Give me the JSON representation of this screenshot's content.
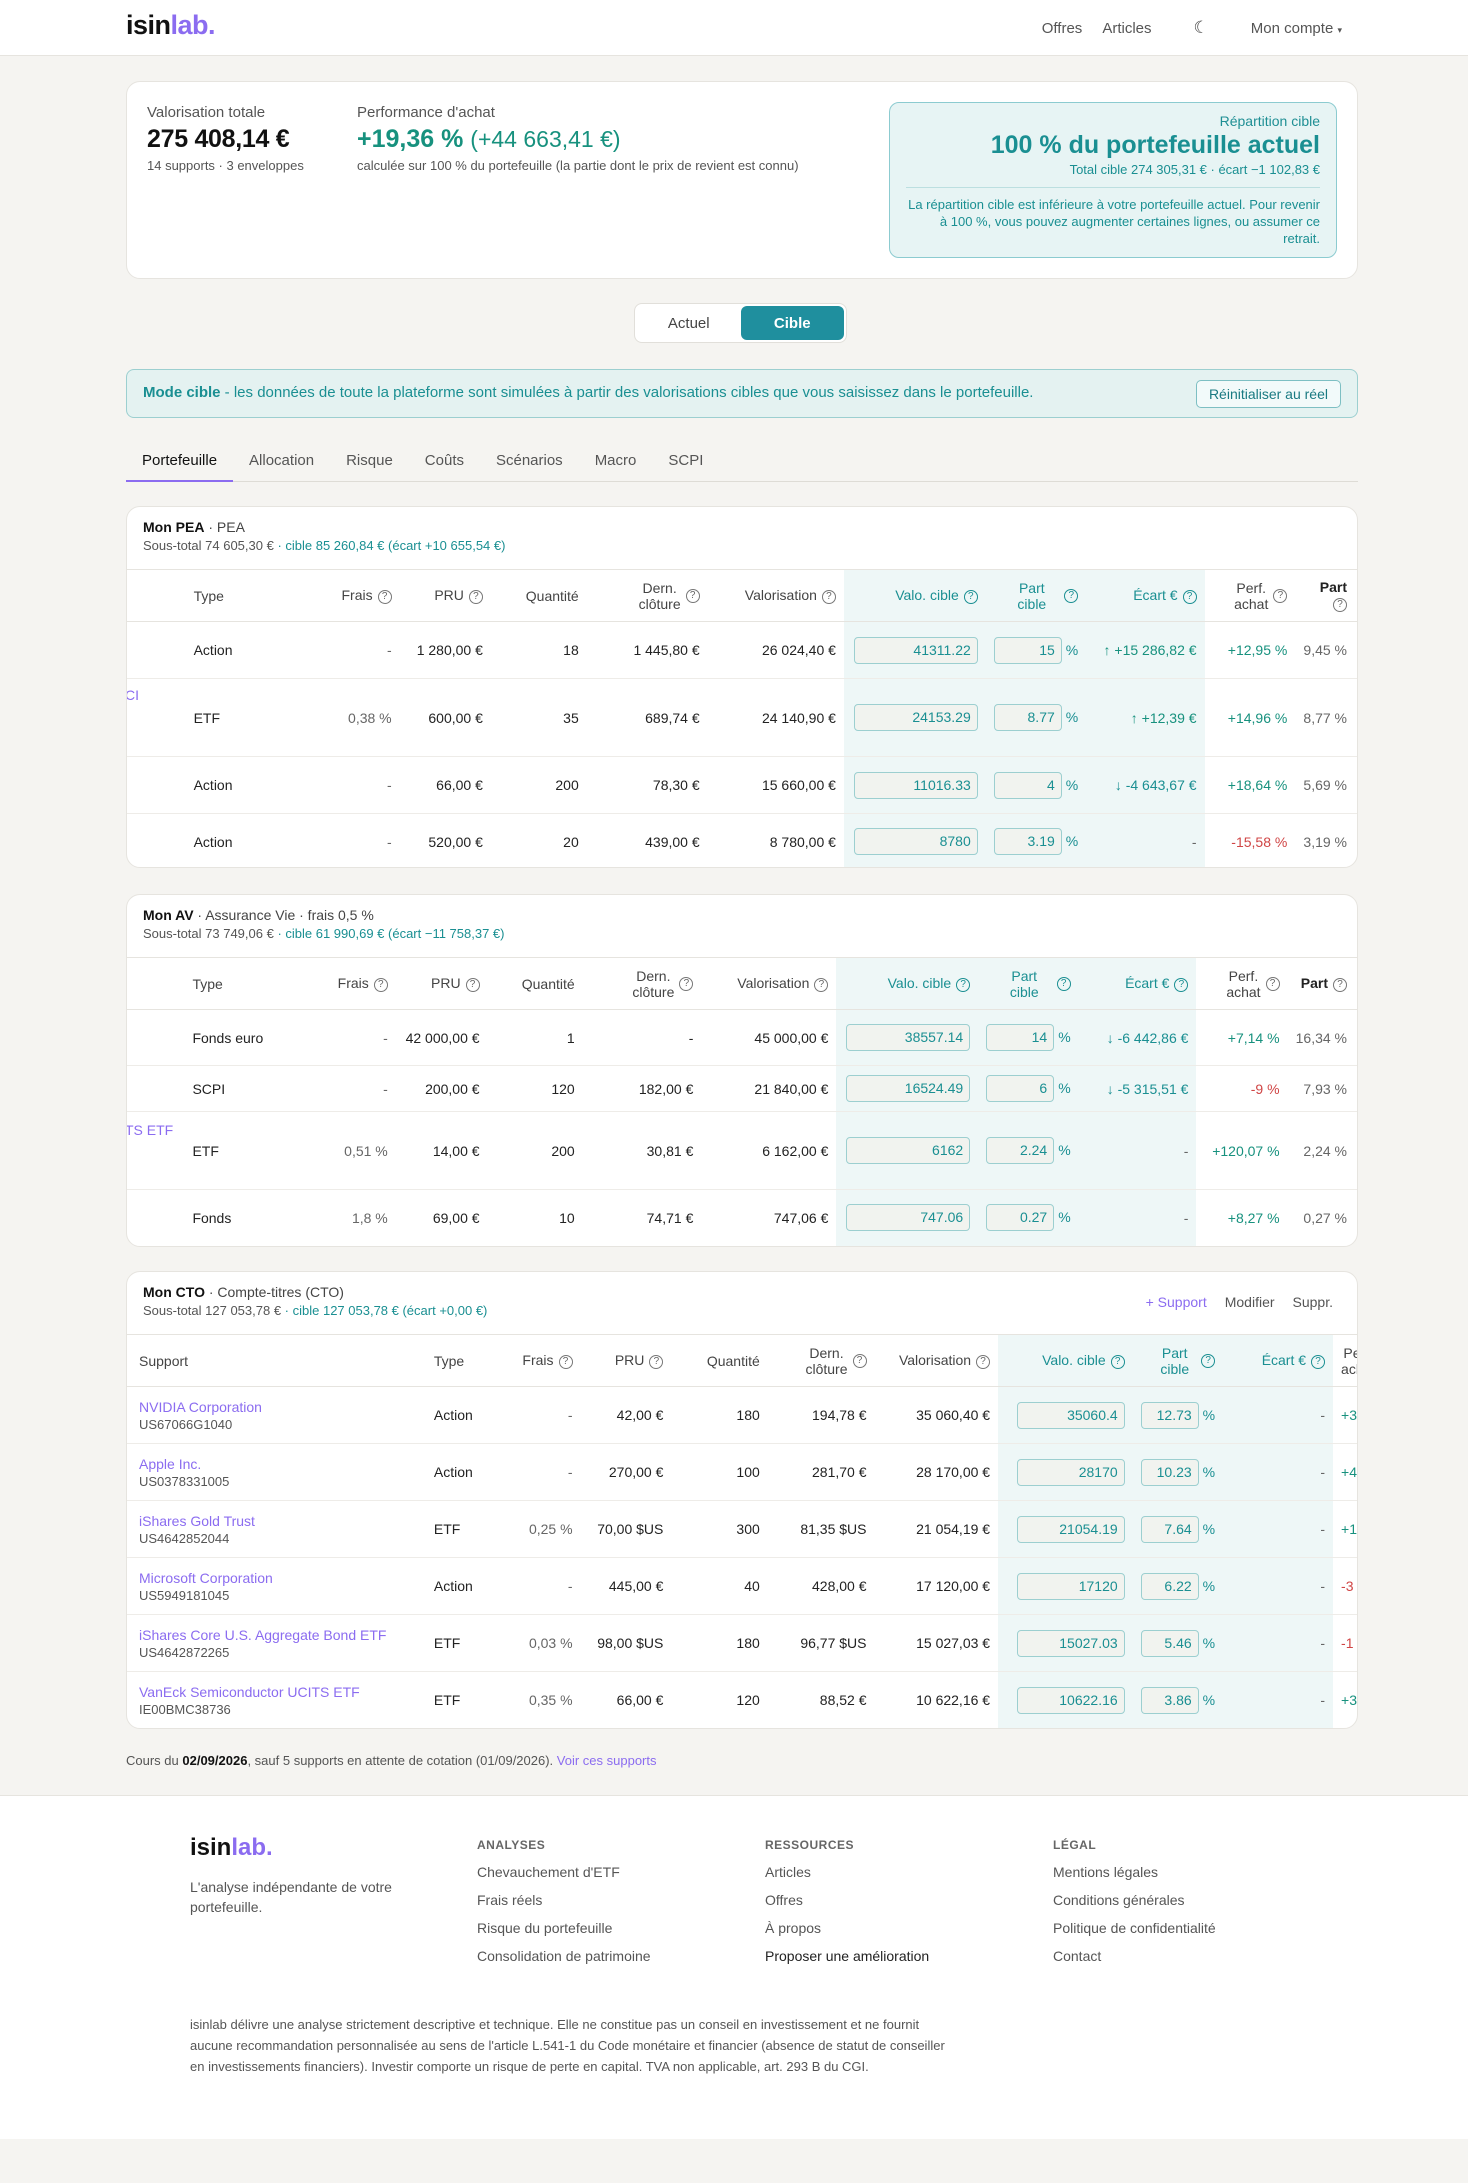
{
  "header": {
    "logo_a": "isin",
    "logo_b": "lab",
    "logo_dot": ".",
    "nav": [
      "Offres",
      "Articles"
    ],
    "theme_icon": "moon-icon",
    "account": "Mon compte"
  },
  "summary": {
    "total_label": "Valorisation totale",
    "total_value": "275 408,14 €",
    "total_sub": "14 supports · 3 enveloppes",
    "perf_label": "Performance d'achat",
    "perf_value": "+19,36 %",
    "perf_abs": "(+44 663,41 €)",
    "perf_sub": "calculée sur 100 % du portefeuille (la partie dont le prix de revient est connu)",
    "target_label": "Répartition cible",
    "target_big": "100 % du portefeuille actuel",
    "target_sub": "Total cible 274 305,31 € · écart −1 102,83 €",
    "target_note": "La répartition cible est inférieure à votre portefeuille actuel. Pour revenir à 100 %, vous pouvez augmenter certaines lignes, ou assumer ce retrait."
  },
  "toggle": {
    "actual": "Actuel",
    "target": "Cible"
  },
  "banner": {
    "title": "Mode cible",
    "text": " - les données de toute la plateforme sont simulées à partir des valorisations cibles que vous saisissez dans le portefeuille.",
    "reset": "Réinitialiser au réel"
  },
  "tabs": [
    "Portefeuille",
    "Allocation",
    "Risque",
    "Coûts",
    "Scénarios",
    "Macro",
    "SCPI"
  ],
  "cols": {
    "support": "Support",
    "type": "Type",
    "frais": "Frais",
    "pru": "PRU",
    "qty": "Quantité",
    "close1": "Dern.",
    "close2": "clôture",
    "valo": "Valorisation",
    "valo_t": "Valo. cible",
    "part_t1": "Part",
    "part_t2": "cible",
    "ecart": "Écart €",
    "perf1": "Perf.",
    "perf2": "achat",
    "part": "Part"
  },
  "pea": {
    "title": "Mon PEA",
    "kind": " · PEA",
    "sub": "Sous-total 74 605,30 € ",
    "sub_target": "· cible 85 260,84 € (écart +10 655,54 €)",
    "stub": "CI",
    "rows": [
      {
        "type": "Action",
        "frais": "-",
        "pru": "1 280,00 €",
        "qty": "18",
        "close": "1 445,80 €",
        "valo": "26 024,40 €",
        "valo_t": "41311.22",
        "part_t": "15",
        "ecart": "↑ +15 286,82 €",
        "perf": "+12,95 %",
        "part": "9,45 %"
      },
      {
        "type": "ETF",
        "frais": "0,38 %",
        "pru": "600,00 €",
        "qty": "35",
        "close": "689,74 €",
        "valo": "24 140,90 €",
        "valo_t": "24153.29",
        "part_t": "8.77",
        "ecart": "↑ +12,39 €",
        "perf": "+14,96 %",
        "part": "8,77 %"
      },
      {
        "type": "Action",
        "frais": "-",
        "pru": "66,00 €",
        "qty": "200",
        "close": "78,30 €",
        "valo": "15 660,00 €",
        "valo_t": "11016.33",
        "part_t": "4",
        "ecart": "↓ -4 643,67 €",
        "perf": "+18,64 %",
        "part": "5,69 %"
      },
      {
        "type": "Action",
        "frais": "-",
        "pru": "520,00 €",
        "qty": "20",
        "close": "439,00 €",
        "valo": "8 780,00 €",
        "valo_t": "8780",
        "part_t": "3.19",
        "ecart": "-",
        "perf": "-15,58 %",
        "part": "3,19 %"
      }
    ]
  },
  "av": {
    "title": "Mon AV",
    "kind": " · Assurance Vie · frais 0,5 %",
    "sub": "Sous-total 73 749,06 € ",
    "sub_target": "· cible 61 990,69 € (écart −11 758,37 €)",
    "stub": "TS ETF",
    "rows": [
      {
        "type": "Fonds euro",
        "frais": "-",
        "pru": "42 000,00 €",
        "qty": "1",
        "close": "-",
        "valo": "45 000,00 €",
        "valo_t": "38557.14",
        "part_t": "14",
        "ecart": "↓ -6 442,86 €",
        "perf": "+7,14 %",
        "part": "16,34 %"
      },
      {
        "type": "SCPI",
        "frais": "-",
        "pru": "200,00 €",
        "qty": "120",
        "close": "182,00 €",
        "valo": "21 840,00 €",
        "valo_t": "16524.49",
        "part_t": "6",
        "ecart": "↓ -5 315,51 €",
        "perf": "-9 %",
        "part": "7,93 %"
      },
      {
        "type": "ETF",
        "frais": "0,51 %",
        "pru": "14,00 €",
        "qty": "200",
        "close": "30,81 €",
        "valo": "6 162,00 €",
        "valo_t": "6162",
        "part_t": "2.24",
        "ecart": "-",
        "perf": "+120,07 %",
        "part": "2,24 %"
      },
      {
        "type": "Fonds",
        "frais": "1,8 %",
        "pru": "69,00 €",
        "qty": "10",
        "close": "74,71 €",
        "valo": "747,06 €",
        "valo_t": "747.06",
        "part_t": "0.27",
        "ecart": "-",
        "perf": "+8,27 %",
        "part": "0,27 %"
      }
    ]
  },
  "cto": {
    "title": "Mon CTO",
    "kind": " · Compte-titres (CTO)",
    "sub": "Sous-total 127 053,78 € ",
    "sub_target": "· cible 127 053,78 € (écart +0,00 €)",
    "actions": {
      "add": "+ Support",
      "edit": "Modifier",
      "del": "Suppr."
    },
    "rows": [
      {
        "name": "NVIDIA Corporation",
        "isin": "US67066G1040",
        "type": "Action",
        "frais": "-",
        "pru": "42,00 €",
        "qty": "180",
        "close": "194,78 €",
        "valo": "35 060,40 €",
        "valo_t": "35060.4",
        "part_t": "12.73",
        "ecart": "-",
        "perf": "+3"
      },
      {
        "name": "Apple Inc.",
        "isin": "US0378331005",
        "type": "Action",
        "frais": "-",
        "pru": "270,00 €",
        "qty": "100",
        "close": "281,70 €",
        "valo": "28 170,00 €",
        "valo_t": "28170",
        "part_t": "10.23",
        "ecart": "-",
        "perf": "+4"
      },
      {
        "name": "iShares Gold Trust",
        "isin": "US4642852044",
        "type": "ETF",
        "frais": "0,25 %",
        "pru": "70,00 $US",
        "qty": "300",
        "close": "81,35 $US",
        "valo": "21 054,19 €",
        "valo_t": "21054.19",
        "part_t": "7.64",
        "ecart": "-",
        "perf": "+1("
      },
      {
        "name": "Microsoft Corporation",
        "isin": "US5949181045",
        "type": "Action",
        "frais": "-",
        "pru": "445,00 €",
        "qty": "40",
        "close": "428,00 €",
        "valo": "17 120,00 €",
        "valo_t": "17120",
        "part_t": "6.22",
        "ecart": "-",
        "perf": "-3"
      },
      {
        "name": "iShares Core U.S. Aggregate Bond ETF",
        "isin": "US4642872265",
        "type": "ETF",
        "frais": "0,03 %",
        "pru": "98,00 $US",
        "qty": "180",
        "close": "96,77 $US",
        "valo": "15 027,03 €",
        "valo_t": "15027.03",
        "part_t": "5.46",
        "ecart": "-",
        "perf": "-1"
      },
      {
        "name": "VanEck Semiconductor UCITS ETF",
        "isin": "IE00BMC38736",
        "type": "ETF",
        "frais": "0,35 %",
        "pru": "66,00 €",
        "qty": "120",
        "close": "88,52 €",
        "valo": "10 622,16 €",
        "valo_t": "10622.16",
        "part_t": "3.86",
        "ecart": "-",
        "perf": "+3"
      }
    ]
  },
  "footnote": {
    "a": "Cours du ",
    "date": "02/09/2026",
    "b": ", sauf 5 supports en attente de cotation (01/09/2026). ",
    "link": "Voir ces supports"
  },
  "footer": {
    "tagline": "L'analyse indépendante de votre portefeuille.",
    "cols": [
      {
        "title": "ANALYSES",
        "items": [
          "Chevauchement d'ETF",
          "Frais réels",
          "Risque du portefeuille",
          "Consolidation de patrimoine"
        ]
      },
      {
        "title": "RESSOURCES",
        "items": [
          "Articles",
          "Offres",
          "À propos",
          "Proposer une amélioration"
        ]
      },
      {
        "title": "LÉGAL",
        "items": [
          "Mentions légales",
          "Conditions générales",
          "Politique de confidentialité",
          "Contact"
        ]
      }
    ],
    "disclaimer": "isinlab délivre une analyse strictement descriptive et technique. Elle ne constitue pas un conseil en investissement et ne fournit aucune recommandation personnalisée au sens de l'article L.541-1 du Code monétaire et financier (absence de statut de conseiller en investissements financiers). Investir comporte un risque de perte en capital. TVA non applicable, art. 293 B du CGI."
  },
  "colors": {
    "accent": "#8b6cf0",
    "teal": "#1a8f92",
    "green": "#17917e",
    "red": "#d04545"
  }
}
